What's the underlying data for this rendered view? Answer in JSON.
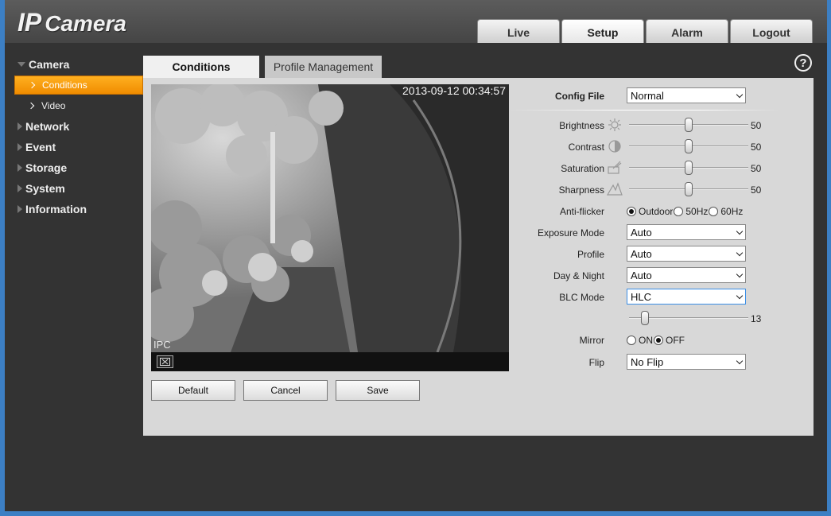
{
  "header": {
    "logo_ip": "IP",
    "logo_camera": "Camera",
    "tabs": [
      {
        "label": "Live"
      },
      {
        "label": "Setup"
      },
      {
        "label": "Alarm"
      },
      {
        "label": "Logout"
      }
    ]
  },
  "sidebar": {
    "camera": "Camera",
    "conditions": "Conditions",
    "video": "Video",
    "network": "Network",
    "event": "Event",
    "storage": "Storage",
    "system": "System",
    "information": "Information"
  },
  "content_tabs": {
    "conditions": "Conditions",
    "profile": "Profile Management"
  },
  "help": "?",
  "video": {
    "timestamp": "2013-09-12 00:34:57",
    "label": "IPC"
  },
  "buttons": {
    "default": "Default",
    "cancel": "Cancel",
    "save": "Save"
  },
  "settings": {
    "config_file": {
      "label": "Config File",
      "value": "Normal"
    },
    "brightness": {
      "label": "Brightness",
      "value": 50
    },
    "contrast": {
      "label": "Contrast",
      "value": 50
    },
    "saturation": {
      "label": "Saturation",
      "value": 50
    },
    "sharpness": {
      "label": "Sharpness",
      "value": 50
    },
    "anti_flicker": {
      "label": "Anti-flicker",
      "options": [
        "Outdoor",
        "50Hz",
        "60Hz"
      ],
      "selected": "Outdoor"
    },
    "exposure_mode": {
      "label": "Exposure Mode",
      "value": "Auto"
    },
    "profile": {
      "label": "Profile",
      "value": "Auto"
    },
    "day_night": {
      "label": "Day & Night",
      "value": "Auto"
    },
    "blc_mode": {
      "label": "BLC Mode",
      "value": "HLC",
      "level": 13
    },
    "mirror": {
      "label": "Mirror",
      "options": [
        "ON",
        "OFF"
      ],
      "selected": "OFF"
    },
    "flip": {
      "label": "Flip",
      "value": "No Flip"
    }
  },
  "colors": {
    "accent_orange": "#f59a10",
    "panel_bg": "#d8d8d8",
    "app_bg": "#333333",
    "frame_blue": "#3c7fc4"
  }
}
